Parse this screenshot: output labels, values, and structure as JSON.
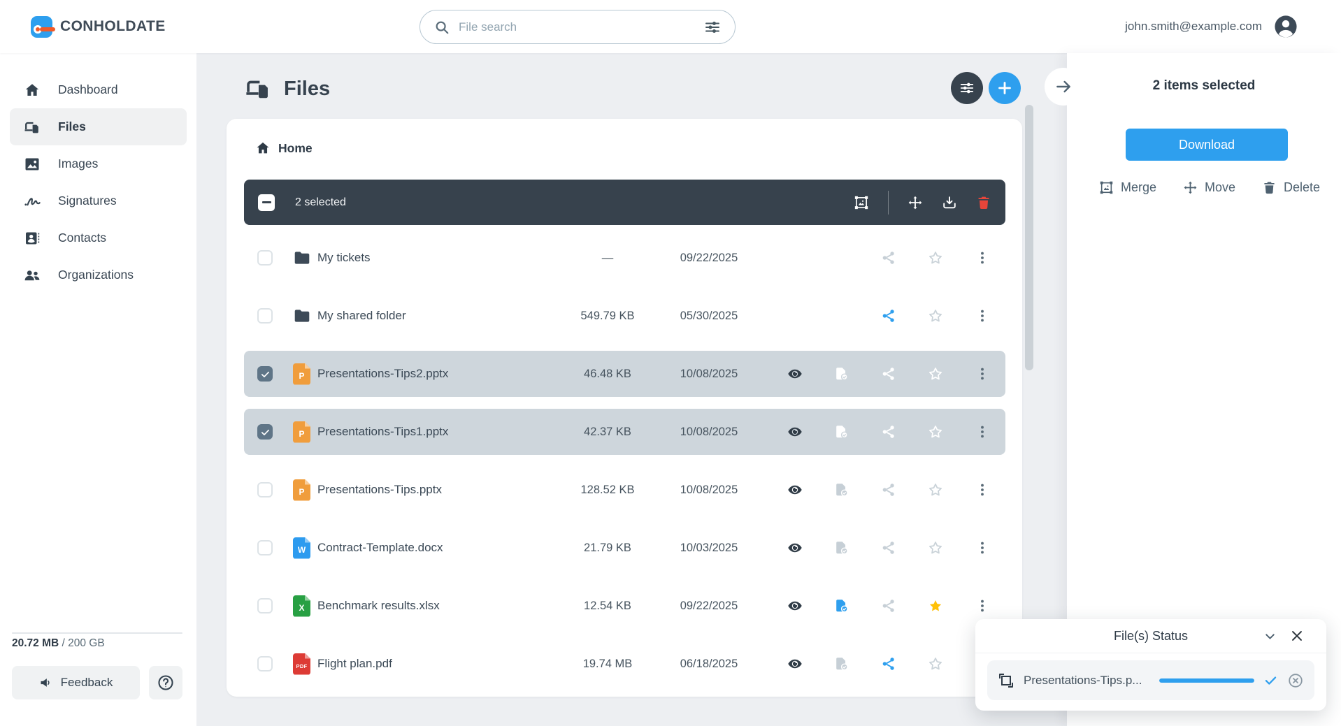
{
  "header": {
    "brand": "CONHOLDATE",
    "search_placeholder": "File search",
    "user_email": "john.smith@example.com"
  },
  "sidebar": {
    "items": [
      {
        "label": "Dashboard",
        "icon": "home",
        "active": false
      },
      {
        "label": "Files",
        "icon": "files",
        "active": true
      },
      {
        "label": "Images",
        "icon": "image",
        "active": false
      },
      {
        "label": "Signatures",
        "icon": "signature",
        "active": false
      },
      {
        "label": "Contacts",
        "icon": "contacts",
        "active": false
      },
      {
        "label": "Organizations",
        "icon": "organizations",
        "active": false
      }
    ],
    "storage_used": "20.72 MB",
    "storage_rest": " / 200 GB",
    "feedback_label": "Feedback"
  },
  "main": {
    "title": "Files",
    "breadcrumb_home": "Home",
    "selection_toolbar": {
      "selected_text": "2 selected",
      "actions": [
        "merge-files",
        "move",
        "download",
        "delete"
      ]
    },
    "rows": [
      {
        "name": "My tickets",
        "type": "folder",
        "letter": "",
        "size": "—",
        "date": "09/22/2025",
        "selected": false,
        "shared": false,
        "approved": false,
        "starred": false
      },
      {
        "name": "My shared folder",
        "type": "folder",
        "letter": "",
        "size": "549.79 KB",
        "date": "05/30/2025",
        "selected": false,
        "shared": true,
        "approved": false,
        "starred": false
      },
      {
        "name": "Presentations-Tips2.pptx",
        "type": "pptx",
        "letter": "P",
        "size": "46.48 KB",
        "date": "10/08/2025",
        "selected": true,
        "shared": false,
        "approved": false,
        "starred": false
      },
      {
        "name": "Presentations-Tips1.pptx",
        "type": "pptx",
        "letter": "P",
        "size": "42.37 KB",
        "date": "10/08/2025",
        "selected": true,
        "shared": false,
        "approved": false,
        "starred": false
      },
      {
        "name": "Presentations-Tips.pptx",
        "type": "pptx",
        "letter": "P",
        "size": "128.52 KB",
        "date": "10/08/2025",
        "selected": false,
        "shared": false,
        "approved": false,
        "starred": false
      },
      {
        "name": "Contract-Template.docx",
        "type": "docx",
        "letter": "W",
        "size": "21.79 KB",
        "date": "10/03/2025",
        "selected": false,
        "shared": false,
        "approved": false,
        "starred": false
      },
      {
        "name": "Benchmark results.xlsx",
        "type": "xlsx",
        "letter": "X",
        "size": "12.54 KB",
        "date": "09/22/2025",
        "selected": false,
        "shared": false,
        "approved": true,
        "starred": true
      },
      {
        "name": "Flight plan.pdf",
        "type": "pdf",
        "letter": "PDF",
        "size": "19.74 MB",
        "date": "06/18/2025",
        "selected": false,
        "shared": true,
        "approved": false,
        "starred": false
      }
    ]
  },
  "right_panel": {
    "title": "2 items selected",
    "download_label": "Download",
    "merge_label": "Merge",
    "move_label": "Move",
    "delete_label": "Delete"
  },
  "status_popup": {
    "title": "File(s) Status",
    "file_name": "Presentations-Tips.p...",
    "progress_percent": 100
  },
  "colors": {
    "accent_blue": "#2e9fee",
    "dark_slate": "#37424d",
    "selected_row": "#ced6dc",
    "star_gold": "#ffc107",
    "trash_red": "#e8453a",
    "filetypes": {
      "pptx": "#f09d3c",
      "docx": "#2d9bef",
      "xlsx": "#28a043",
      "pdf": "#dd3b35",
      "folder": "#3d4a57"
    }
  }
}
